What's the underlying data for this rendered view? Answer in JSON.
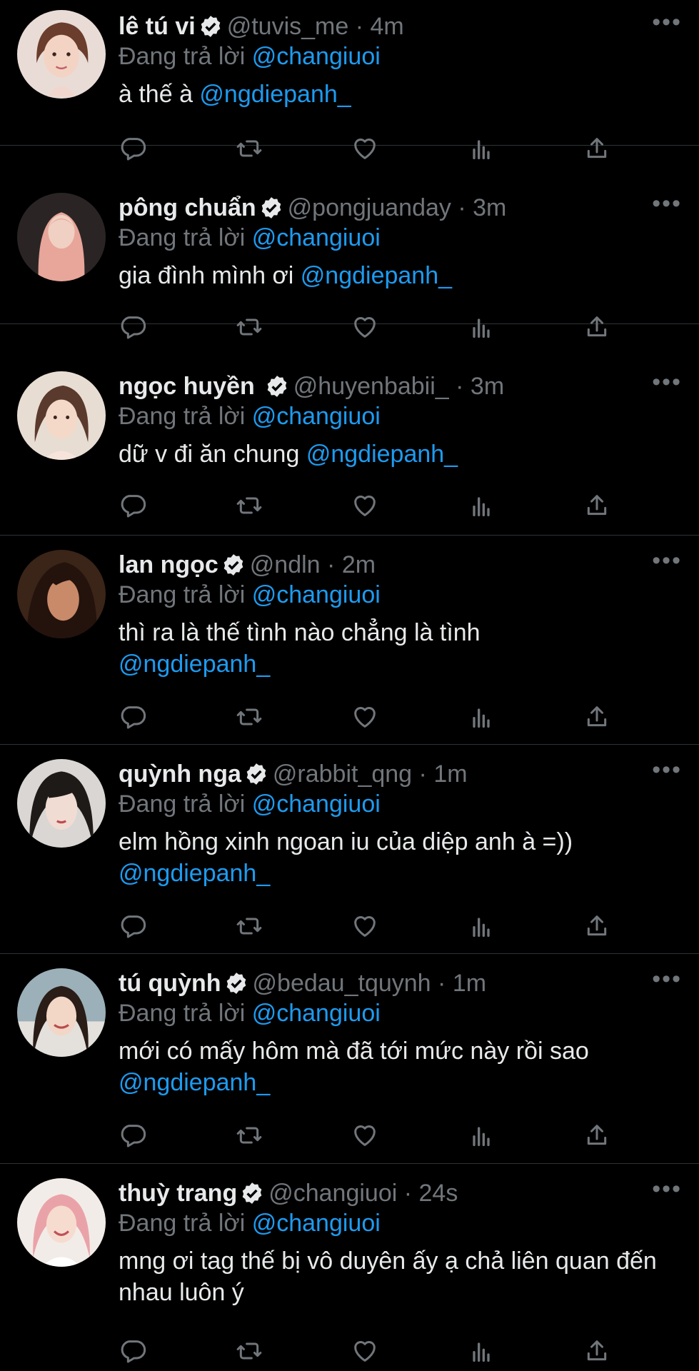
{
  "reply_prefix": "Đang trả lời",
  "colors": {
    "background": "#000000",
    "text": "#e7e9ea",
    "muted": "#71767b",
    "link": "#1d9bf0",
    "divider": "#2f3336"
  },
  "icons": [
    "more-icon",
    "verified-badge-icon",
    "reply-icon",
    "retweet-icon",
    "like-icon",
    "views-icon",
    "share-icon"
  ],
  "tweets": [
    {
      "name": "lê tú vi",
      "handle": "@tuvis_me",
      "time": "4m",
      "replying_to": "@changiuoi",
      "text_prefix": "à thế à ",
      "mention": "@ngdiepanh_"
    },
    {
      "name": "pông chuẩn",
      "handle": "@pongjuanday",
      "time": "3m",
      "replying_to": "@changiuoi",
      "text_prefix": "gia đình mình ơi ",
      "mention": "@ngdiepanh_"
    },
    {
      "name": "ngọc huyền",
      "handle": "@huyenbabii_",
      "time": "3m",
      "replying_to": "@changiuoi",
      "text_prefix": "dữ v đi ăn chung ",
      "mention": "@ngdiepanh_"
    },
    {
      "name": "lan ngọc",
      "handle": "@ndln",
      "time": "2m",
      "replying_to": "@changiuoi",
      "text_prefix": "thì ra là thế tình nào chẳng là tình\n",
      "mention": "@ngdiepanh_"
    },
    {
      "name": "quỳnh nga",
      "handle": "@rabbit_qng",
      "time": "1m",
      "replying_to": "@changiuoi",
      "text_prefix": "elm hồng xinh ngoan iu của diệp anh à =))\n",
      "mention": "@ngdiepanh_"
    },
    {
      "name": "tú quỳnh",
      "handle": "@bedau_tquynh",
      "time": "1m",
      "replying_to": "@changiuoi",
      "text_prefix": "mới có mấy hôm mà đã tới mức này rồi sao\n",
      "mention": "@ngdiepanh_"
    },
    {
      "name": "thuỳ trang",
      "handle": "@changiuoi",
      "time": "24s",
      "replying_to": "@changiuoi",
      "text_prefix": "mng ơi tag thế bị vô duyên ấy ạ chả liên quan đến nhau luôn ý",
      "mention": ""
    }
  ]
}
